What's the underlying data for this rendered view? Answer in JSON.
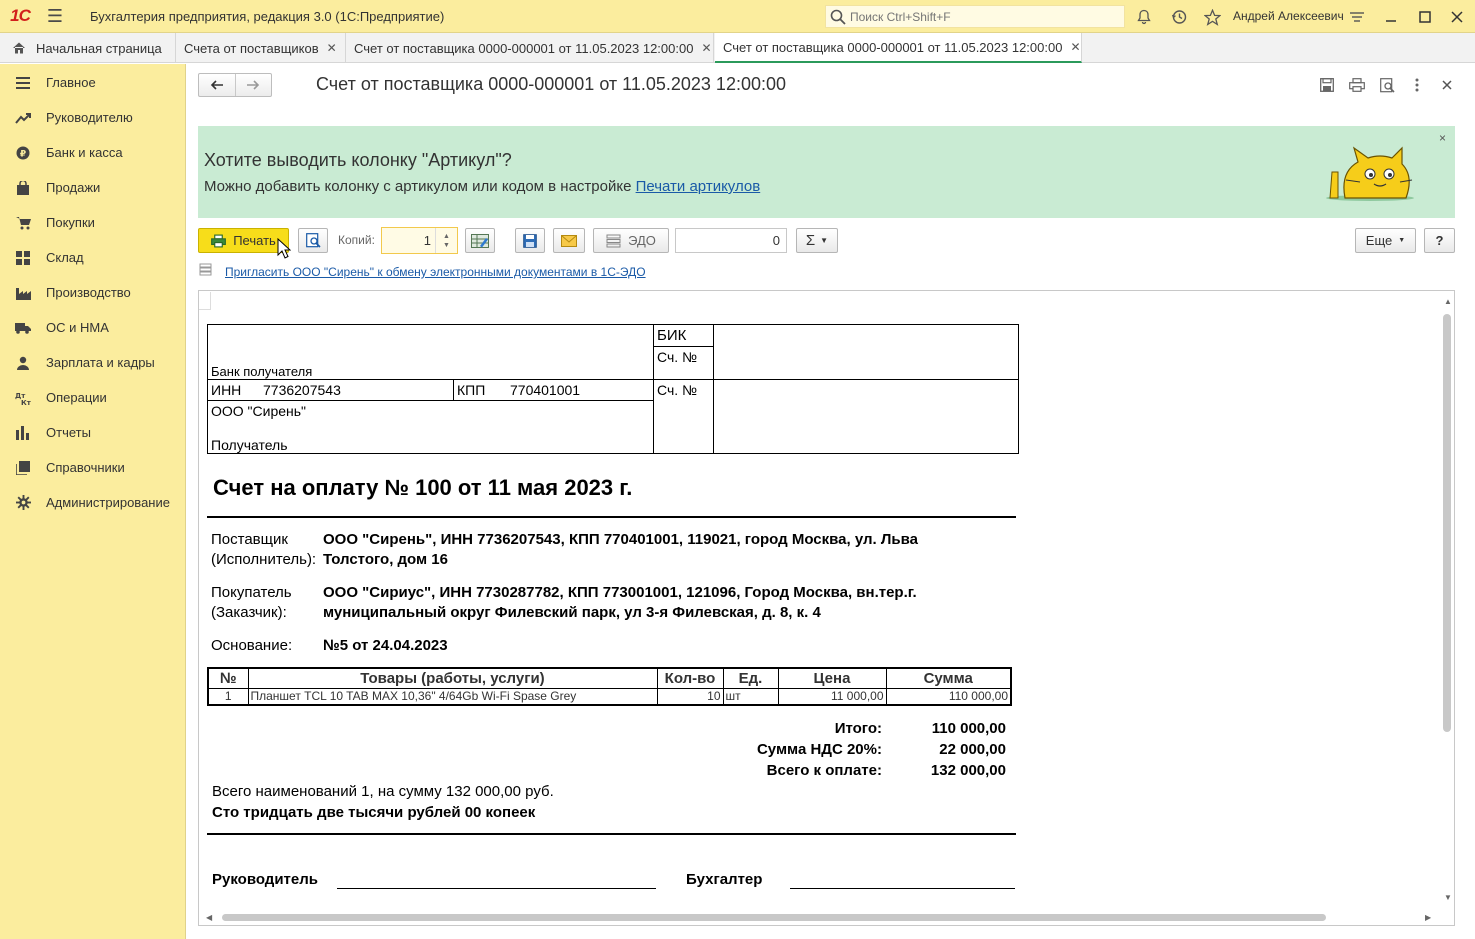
{
  "app": {
    "logo": "1С",
    "title": "Бухгалтерия предприятия, редакция 3.0  (1С:Предприятие)",
    "search_placeholder": "Поиск Ctrl+Shift+F",
    "user": "Андрей Алексеевич"
  },
  "tabs": [
    {
      "label": "Начальная страница",
      "icon": "home-icon"
    },
    {
      "label": "Счета от поставщиков",
      "close": "✕"
    },
    {
      "label": "Счет от поставщика 0000-000001 от 11.05.2023 12:00:00",
      "close": "✕"
    },
    {
      "label": "Счет от поставщика 0000-000001 от 11.05.2023 12:00:00",
      "close": "✕",
      "active": true
    }
  ],
  "sidebar": {
    "items": [
      {
        "label": "Главное",
        "icon": "menu-lines-icon"
      },
      {
        "label": "Руководителю",
        "icon": "trend-icon"
      },
      {
        "label": "Банк и касса",
        "icon": "ruble-coin-icon"
      },
      {
        "label": "Продажи",
        "icon": "shopping-bag-icon"
      },
      {
        "label": "Покупки",
        "icon": "cart-icon"
      },
      {
        "label": "Склад",
        "icon": "warehouse-icon"
      },
      {
        "label": "Производство",
        "icon": "factory-icon"
      },
      {
        "label": "ОС и НМА",
        "icon": "truck-icon"
      },
      {
        "label": "Зарплата и кадры",
        "icon": "person-icon"
      },
      {
        "label": "Операции",
        "icon": "debit-credit-icon"
      },
      {
        "label": "Отчеты",
        "icon": "bar-chart-icon"
      },
      {
        "label": "Справочники",
        "icon": "books-icon"
      },
      {
        "label": "Администрирование",
        "icon": "gear-icon"
      }
    ]
  },
  "form": {
    "title": "Счет от поставщика 0000-000001 от 11.05.2023 12:00:00"
  },
  "banner": {
    "title": "Хотите выводить колонку \"Артикул\"?",
    "text": "Можно добавить колонку с артикулом или кодом в настройке ",
    "link": "Печати артикулов",
    "close": "×"
  },
  "toolbar": {
    "print_label": "Печать",
    "copies_label": "Копий:",
    "copies_value": "1",
    "edo_label": "ЭДО",
    "sum_value": "0",
    "sigma_label": "Σ",
    "more_label": "Еще",
    "help_label": "?"
  },
  "edo_link": "Пригласить ООО \"Сирень\" к обмену электронными документами в 1С-ЭДО",
  "document": {
    "bank": {
      "bik_label": "БИК",
      "acc_label": "Сч. №",
      "bank_label": "Банк получателя",
      "inn_label": "ИНН",
      "inn_value": "7736207543",
      "kpp_label": "КПП",
      "kpp_value": "770401001",
      "acc2_label": "Сч. №",
      "recipient_name": "ООО \"Сирень\"",
      "recipient_label": "Получатель"
    },
    "title": "Счет на оплату № 100 от 11 мая 2023 г.",
    "supplier_label_1": "Поставщик",
    "supplier_label_2": "(Исполнитель):",
    "supplier_line_1": "ООО \"Сирень\", ИНН 7736207543, КПП 770401001, 119021, город Москва, ул. Льва",
    "supplier_line_2": "Толстого, дом 16",
    "buyer_label_1": "Покупатель",
    "buyer_label_2": "(Заказчик):",
    "buyer_line_1": "ООО \"Сириус\", ИНН 7730287782, КПП 773001001, 121096, Город Москва, вн.тер.г.",
    "buyer_line_2": "муниципальный округ Филевский парк, ул 3-я Филевская, д. 8, к. 4",
    "basis_label": "Основание:",
    "basis_value": "№5 от 24.04.2023",
    "table": {
      "headers": [
        "№",
        "Товары (работы, услуги)",
        "Кол-во",
        "Ед.",
        "Цена",
        "Сумма"
      ],
      "rows": [
        [
          "1",
          "Планшет TCL 10 TAB MAX 10,36\" 4/64Gb Wi-Fi Spase Grey",
          "10",
          "шт",
          "11 000,00",
          "110 000,00"
        ]
      ]
    },
    "totals": [
      {
        "label": "Итого:",
        "value": "110 000,00"
      },
      {
        "label": "Сумма НДС 20%:",
        "value": "22 000,00"
      },
      {
        "label": "Всего к оплате:",
        "value": "132 000,00"
      }
    ],
    "summary_line": "Всего наименований 1, на сумму 132 000,00 руб.",
    "amount_words": "Сто тридцать две тысячи рублей 00 копеек",
    "sign_head": "Руководитель",
    "sign_accountant": "Бухгалтер"
  },
  "colors": {
    "topbar": "#fbed9e",
    "banner": "#c9ebd3",
    "print_button": "#f7dd1a",
    "link": "#1a5aa7",
    "active_tab_accent": "#2b9a5b"
  }
}
